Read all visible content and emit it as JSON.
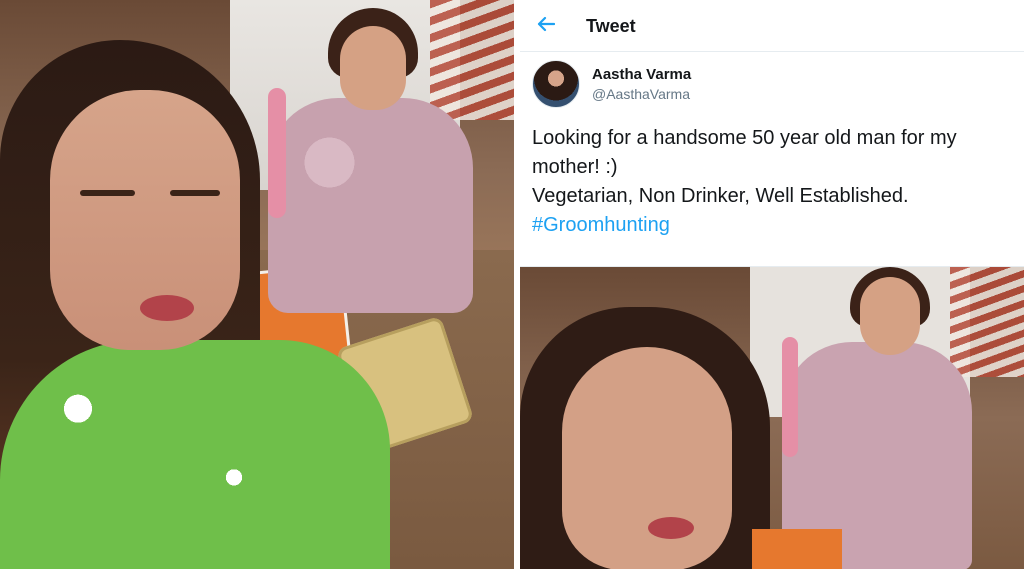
{
  "tweet": {
    "header_title": "Tweet",
    "back_icon": "back-arrow-icon",
    "author": {
      "display_name": "Aastha Varma",
      "handle": "@AasthaVarma"
    },
    "text": "Looking for a handsome 50 year old man for my\nmother! :)\nVegetarian, Non Drinker, Well Established.",
    "hashtag": "#Groomhunting",
    "link_color": "#1da1f2"
  },
  "photos": {
    "left_photo": "selfie-photo",
    "tweet_photo": "selfie-photo"
  }
}
